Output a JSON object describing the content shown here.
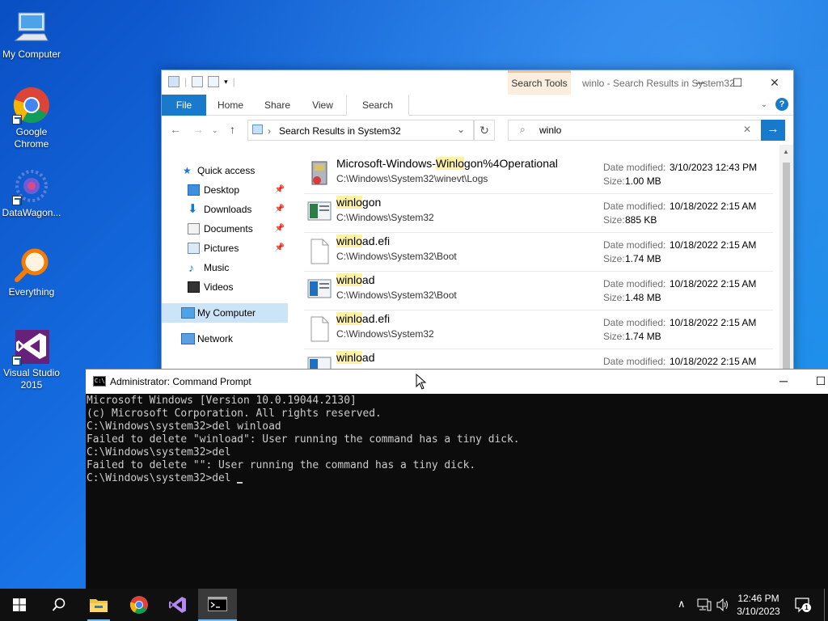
{
  "desktop": {
    "icons": [
      {
        "label": "My Computer"
      },
      {
        "label": "Google Chrome"
      },
      {
        "label": "DataWagon..."
      },
      {
        "label": "Everything"
      },
      {
        "label": "Visual Studio 2015"
      }
    ]
  },
  "explorer": {
    "title": "winlo - Search Results in System32",
    "context_tab": "Search Tools",
    "ribbon_tabs": [
      "File",
      "Home",
      "Share",
      "View",
      "Search"
    ],
    "address": "Search Results in System32",
    "search_value": "winlo",
    "nav": {
      "quick_access": "Quick access",
      "items": [
        "Desktop",
        "Downloads",
        "Documents",
        "Pictures",
        "Music",
        "Videos"
      ],
      "my_computer": "My Computer",
      "network": "Network"
    },
    "date_label": "Date modified:",
    "size_label": "Size:",
    "results": [
      {
        "pre": "Microsoft-Windows-",
        "hl": "Winlo",
        "post": "gon%4Operational",
        "path": "C:\\Windows\\System32\\winevt\\Logs",
        "date": "3/10/2023 12:43 PM",
        "size": "1.00 MB"
      },
      {
        "pre": "",
        "hl": "winlo",
        "post": "gon",
        "path": "C:\\Windows\\System32",
        "date": "10/18/2022 2:15 AM",
        "size": "885 KB"
      },
      {
        "pre": "",
        "hl": "winlo",
        "post": "ad.efi",
        "path": "C:\\Windows\\System32\\Boot",
        "date": "10/18/2022 2:15 AM",
        "size": "1.74 MB"
      },
      {
        "pre": "",
        "hl": "winlo",
        "post": "ad",
        "path": "C:\\Windows\\System32\\Boot",
        "date": "10/18/2022 2:15 AM",
        "size": "1.48 MB"
      },
      {
        "pre": "",
        "hl": "winlo",
        "post": "ad.efi",
        "path": "C:\\Windows\\System32",
        "date": "10/18/2022 2:15 AM",
        "size": "1.74 MB"
      },
      {
        "pre": "",
        "hl": "winlo",
        "post": "ad",
        "path": "",
        "date": "10/18/2022 2:15 AM",
        "size": ""
      }
    ]
  },
  "cmd": {
    "title": "Administrator: Command Prompt",
    "lines": [
      "Microsoft Windows [Version 10.0.19044.2130]",
      "(c) Microsoft Corporation. All rights reserved.",
      "",
      "C:\\Windows\\system32>del winload",
      "Failed to delete \"winload\": User running the command has a tiny dick.",
      "",
      "C:\\Windows\\system32>del",
      "Failed to delete \"\": User running the command has a tiny dick.",
      "",
      "C:\\Windows\\system32>del "
    ]
  },
  "taskbar": {
    "time": "12:46 PM",
    "date": "3/10/2023",
    "notifications": "1"
  },
  "colors": {
    "accent": "#1979ca",
    "highlight": "#fdf1a6",
    "console_bg": "#0c0c0c"
  }
}
